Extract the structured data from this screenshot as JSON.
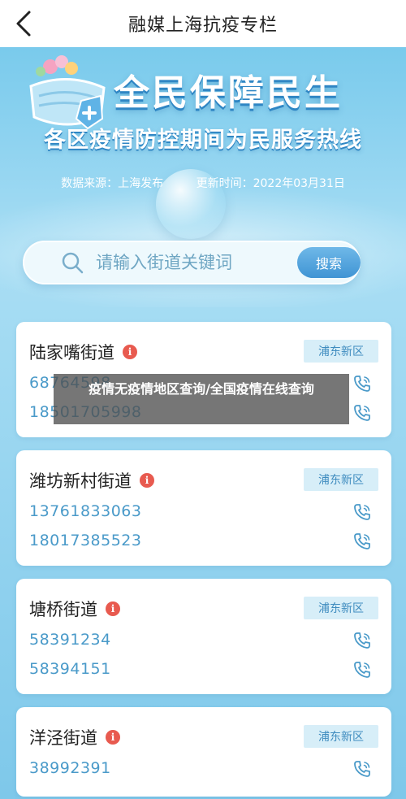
{
  "header": {
    "title": "融媒上海抗疫专栏",
    "back_icon": "chevron-left-icon"
  },
  "hero": {
    "title": "全民保障民生",
    "subtitle": "各区疫情防控期间为民服务热线",
    "source": "数据来源：上海发布",
    "updated": "更新时间：2022年03月31日"
  },
  "search": {
    "placeholder": "请输入街道关键词",
    "value": "",
    "button_label": "搜索"
  },
  "cards": [
    {
      "name": "陆家嘴街道",
      "district": "浦东新区",
      "phones": [
        "68764598",
        "18501705998"
      ]
    },
    {
      "name": "潍坊新村街道",
      "district": "浦东新区",
      "phones": [
        "13761833063",
        "18017385523"
      ]
    },
    {
      "name": "塘桥街道",
      "district": "浦东新区",
      "phones": [
        "58391234",
        "58394151"
      ]
    },
    {
      "name": "洋泾街道",
      "district": "浦东新区",
      "phones": [
        "38992391"
      ]
    }
  ],
  "overlay": {
    "text": "疫情无疫情地区查询/全国疫情在线查询"
  },
  "colors": {
    "accent": "#3f94d4",
    "phone_text": "#4a9ac9",
    "info_badge": "#e85a4f",
    "tag_bg": "#d7eef8"
  }
}
